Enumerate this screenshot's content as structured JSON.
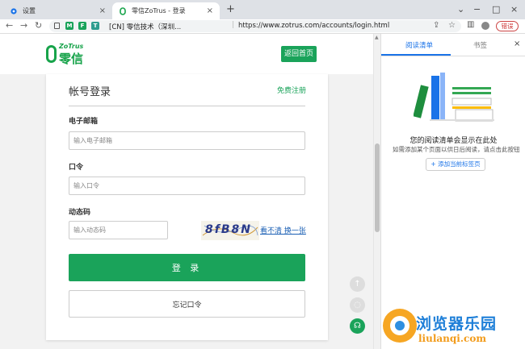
{
  "browser": {
    "tabs": [
      {
        "label": "设置",
        "icon": "gear-icon",
        "active": false
      },
      {
        "label": "零信ZoTrus - 登录",
        "icon": "zotrus-favicon",
        "active": true
      }
    ],
    "new_tab_symbol": "+",
    "close_symbol": "×",
    "window_controls": {
      "minimize": "−",
      "maximize": "□",
      "close": "×",
      "dropdown": "⌄"
    },
    "nav": {
      "back": "←",
      "forward": "→",
      "reload": "↻"
    },
    "extensions": [
      "M",
      "F",
      "T"
    ],
    "site_chip": "[CN] 零信技术（深圳...",
    "url": "https://www.zotrus.com/accounts/login.html",
    "error_button": "错误"
  },
  "header": {
    "logo_brand": "ZoTrus",
    "logo_cn": "零信",
    "home_button": "返回首页"
  },
  "login": {
    "title": "帐号登录",
    "register_link": "免费注册",
    "email_label": "电子邮箱",
    "email_placeholder": "输入电子邮箱",
    "password_label": "口令",
    "password_placeholder": "输入口令",
    "code_label": "动态码",
    "code_placeholder": "输入动态码",
    "captcha_text": "8fB8N",
    "refresh_link": "看不清 换一张",
    "login_button": "登 录",
    "forgot_button": "忘记口令"
  },
  "side_panel": {
    "tabs": [
      "阅读清单",
      "书签"
    ],
    "close": "×",
    "empty_title": "您的阅读清单会显示在此处",
    "empty_desc": "如需添加某个页面以供日后阅读，请点击此按钮",
    "add_button": "+ 添加当前标签页"
  },
  "watermark": {
    "cn": "浏览器乐园",
    "en": "liulanqi.com"
  },
  "colors": {
    "brand_green": "#1aa35a",
    "link_blue": "#1a73e8",
    "tab_bg": "#dee1e6"
  }
}
